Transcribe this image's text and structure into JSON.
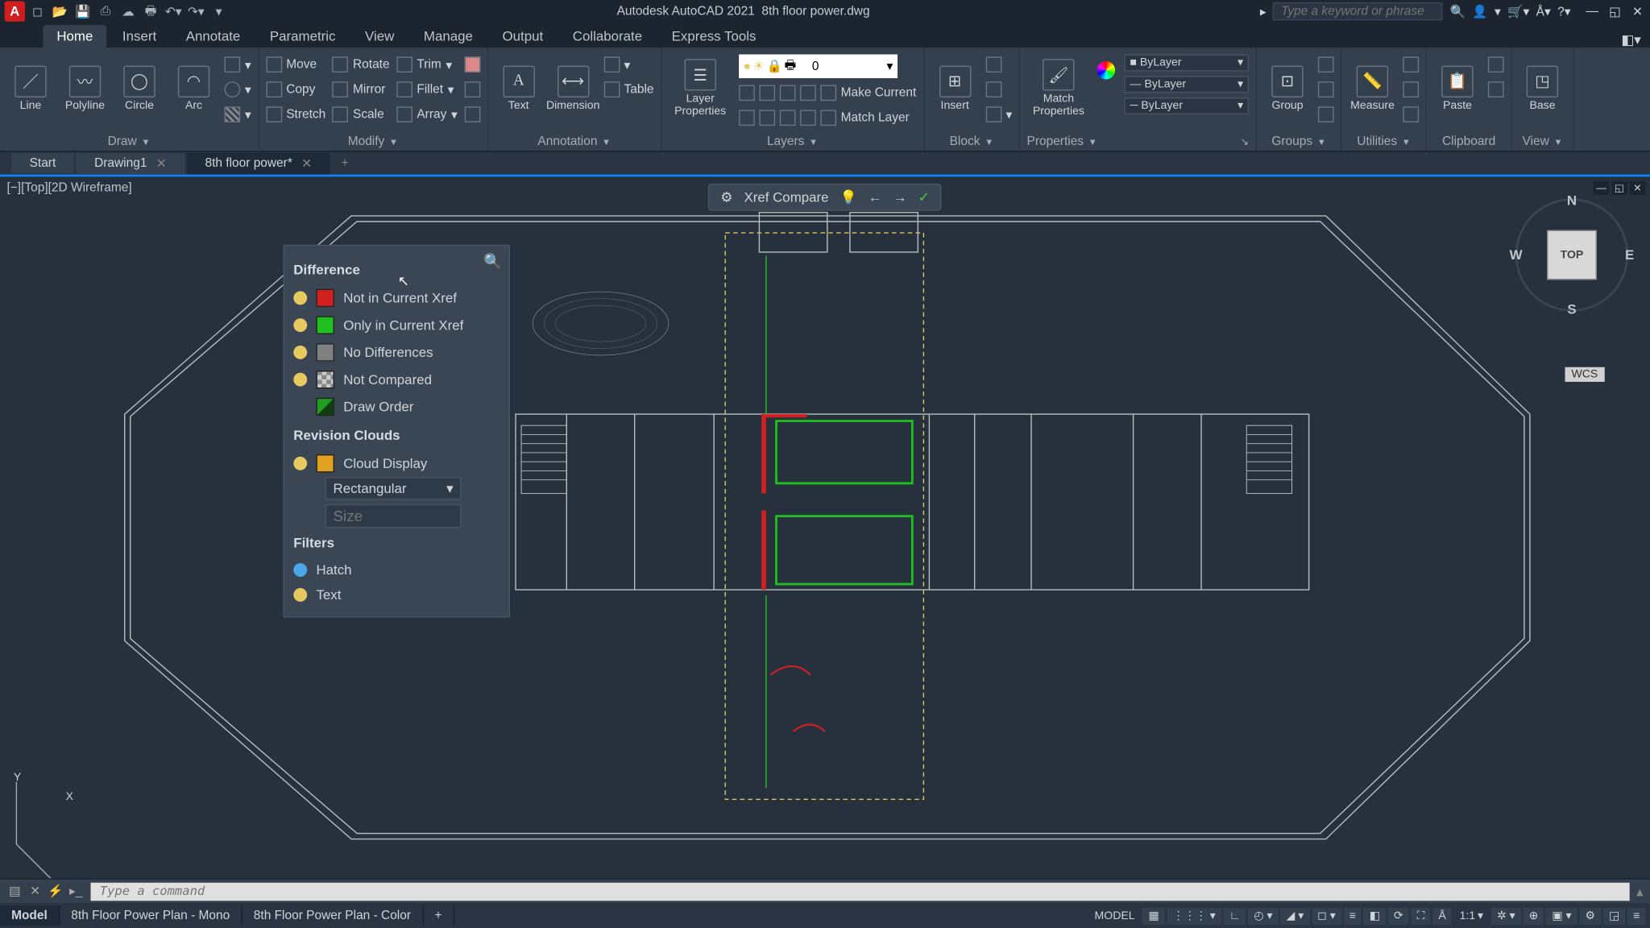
{
  "app": {
    "name": "Autodesk AutoCAD 2021",
    "document": "8th floor power.dwg",
    "search_placeholder": "Type a keyword or phrase"
  },
  "ribbon_tabs": [
    "Home",
    "Insert",
    "Annotate",
    "Parametric",
    "View",
    "Manage",
    "Output",
    "Collaborate",
    "Express Tools"
  ],
  "active_ribbon_tab": "Home",
  "panels": {
    "draw": {
      "label": "Draw",
      "tools": [
        "Line",
        "Polyline",
        "Circle",
        "Arc"
      ]
    },
    "modify": {
      "label": "Modify",
      "tools": [
        "Move",
        "Copy",
        "Stretch",
        "Rotate",
        "Mirror",
        "Scale",
        "Trim",
        "Fillet",
        "Array"
      ]
    },
    "annotation": {
      "label": "Annotation",
      "tools": [
        "Text",
        "Dimension",
        "Table"
      ]
    },
    "layers": {
      "label": "Layers",
      "props_label": "Layer Properties",
      "current_layer": "0",
      "make_current": "Make Current",
      "match_layer": "Match Layer"
    },
    "block": {
      "label": "Block",
      "insert": "Insert"
    },
    "properties": {
      "label": "Properties",
      "match": "Match Properties",
      "bylayer": "ByLayer"
    },
    "groups": {
      "label": "Groups",
      "group": "Group"
    },
    "utilities": {
      "label": "Utilities",
      "measure": "Measure"
    },
    "clipboard": {
      "label": "Clipboard",
      "paste": "Paste"
    },
    "view": {
      "label": "View",
      "base": "Base"
    }
  },
  "file_tabs": [
    {
      "label": "Start",
      "closable": false
    },
    {
      "label": "Drawing1",
      "closable": true
    },
    {
      "label": "8th floor power*",
      "closable": true,
      "active": true
    }
  ],
  "viewport": {
    "label": "[−][Top][2D Wireframe]",
    "navcube": "TOP",
    "wcs": "WCS"
  },
  "compare_toolbar": {
    "label": "Xref Compare"
  },
  "diff_panel": {
    "difference_hdr": "Difference",
    "items": [
      {
        "color": "#d02020",
        "label": "Not in Current Xref"
      },
      {
        "color": "#20c020",
        "label": "Only in Current Xref"
      },
      {
        "color": "#808080",
        "label": "No Differences"
      },
      {
        "color": "checker",
        "label": "Not Compared"
      },
      {
        "color": "#20a020",
        "label": "Draw Order",
        "no_bulb": true
      }
    ],
    "revclouds_hdr": "Revision Clouds",
    "cloud_display": {
      "color": "#e0a020",
      "label": "Cloud Display"
    },
    "shape_select": "Rectangular",
    "size_label": "Size",
    "filters_hdr": "Filters",
    "filters": [
      {
        "label": "Hatch"
      },
      {
        "label": "Text"
      }
    ]
  },
  "cmdline": {
    "placeholder": "Type a command"
  },
  "layout_tabs": [
    {
      "label": "Model",
      "active": true
    },
    {
      "label": "8th Floor Power Plan - Mono"
    },
    {
      "label": "8th Floor Power Plan - Color"
    }
  ],
  "statusbar": {
    "model": "MODEL",
    "scale": "1:1"
  }
}
